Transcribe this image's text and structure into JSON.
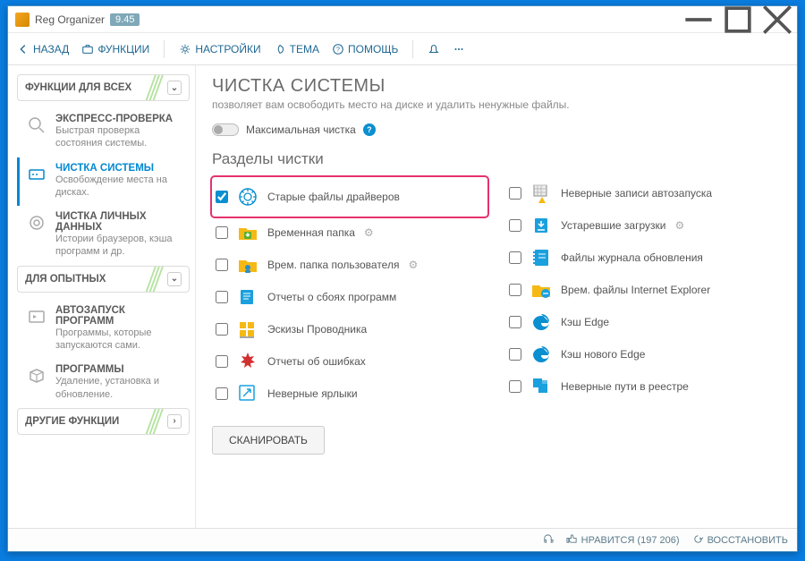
{
  "app": {
    "title": "Reg Organizer",
    "version": "9.45"
  },
  "toolbar": {
    "back": "НАЗАД",
    "functions": "ФУНКЦИИ",
    "settings": "НАСТРОЙКИ",
    "theme": "ТЕМА",
    "help": "ПОМОЩЬ"
  },
  "sidebar": {
    "section_all": "ФУНКЦИИ ДЛЯ ВСЕХ",
    "section_expert": "ДЛЯ ОПЫТНЫХ",
    "section_other": "ДРУГИЕ ФУНКЦИИ",
    "items": [
      {
        "title": "ЭКСПРЕСС-ПРОВЕРКА",
        "desc": "Быстрая проверка состояния системы."
      },
      {
        "title": "ЧИСТКА СИСТЕМЫ",
        "desc": "Освобождение места на дисках."
      },
      {
        "title": "ЧИСТКА ЛИЧНЫХ ДАННЫХ",
        "desc": "Истории браузеров, кэша программ и др."
      }
    ],
    "expert_items": [
      {
        "title": "АВТОЗАПУСК ПРОГРАММ",
        "desc": "Программы, которые запускаются сами."
      },
      {
        "title": "ПРОГРАММЫ",
        "desc": "Удаление, установка и обновление."
      }
    ]
  },
  "main": {
    "title": "ЧИСТКА СИСТЕМЫ",
    "subtitle": "позволяет вам освободить место на диске и удалить ненужные файлы.",
    "max_clean": "Максимальная чистка",
    "sections_title": "Разделы чистки",
    "scan_button": "СКАНИРОВАТЬ",
    "items_left": [
      {
        "label": "Старые файлы драйверов",
        "checked": true,
        "highlight": true,
        "gear": false
      },
      {
        "label": "Временная папка",
        "checked": false,
        "gear": true
      },
      {
        "label": "Врем. папка пользователя",
        "checked": false,
        "gear": true
      },
      {
        "label": "Отчеты о сбоях программ",
        "checked": false,
        "gear": false
      },
      {
        "label": "Эскизы Проводника",
        "checked": false,
        "gear": false
      },
      {
        "label": "Отчеты об ошибках",
        "checked": false,
        "gear": false
      },
      {
        "label": "Неверные ярлыки",
        "checked": false,
        "gear": false
      }
    ],
    "items_right": [
      {
        "label": "Неверные записи автозапуска",
        "checked": false,
        "gear": false
      },
      {
        "label": "Устаревшие загрузки",
        "checked": false,
        "gear": true
      },
      {
        "label": "Файлы журнала обновления",
        "checked": false,
        "gear": false
      },
      {
        "label": "Врем. файлы Internet Explorer",
        "checked": false,
        "gear": false
      },
      {
        "label": "Кэш Edge",
        "checked": false,
        "gear": false
      },
      {
        "label": "Кэш нового Edge",
        "checked": false,
        "gear": false
      },
      {
        "label": "Неверные пути в реестре",
        "checked": false,
        "gear": false
      }
    ]
  },
  "statusbar": {
    "like": "НРАВИТСЯ (197 206)",
    "restore": "ВОССТАНОВИТЬ"
  }
}
